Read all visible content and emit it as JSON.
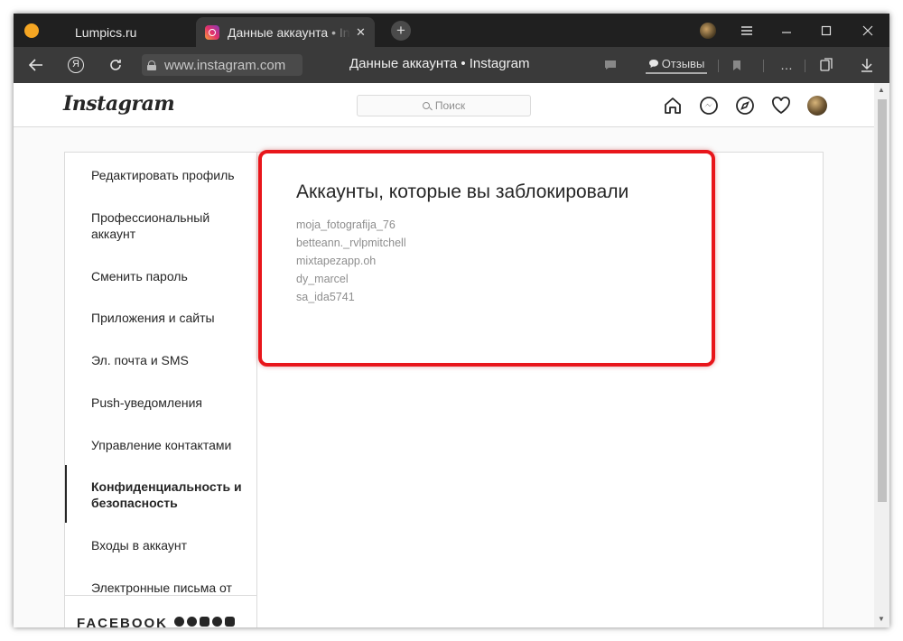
{
  "browser": {
    "tabs": [
      {
        "title": "Lumpics.ru",
        "active": false
      },
      {
        "title": "Данные аккаунта • Instagram",
        "active": true
      }
    ],
    "url": "www.instagram.com",
    "page_title": "Данные аккаунта • Instagram",
    "reviews_label": "Отзывы"
  },
  "instagram": {
    "logo": "Instagram",
    "search_placeholder": "Поиск",
    "sidebar": [
      "Редактировать профиль",
      "Профессиональный аккаунт",
      "Сменить пароль",
      "Приложения и сайты",
      "Эл. почта и SMS",
      "Push-уведомления",
      "Управление контактами",
      "Конфиденциальность и безопасность",
      "Входы в аккаунт",
      "Электронные письма от"
    ],
    "active_sidebar_index": 7,
    "footer_brand": "FACEBOOK",
    "blocked_title": "Аккаунты, которые вы заблокировали",
    "blocked_accounts": [
      "moja_fotografija_76",
      "betteann._rvlpmitchell",
      "mixtapezapp.oh",
      "dy_marcel",
      "sa_ida5741"
    ]
  },
  "colors": {
    "highlight": "#e8161b",
    "browser_dark": "#202020",
    "toolbar": "#3a3a3a"
  }
}
